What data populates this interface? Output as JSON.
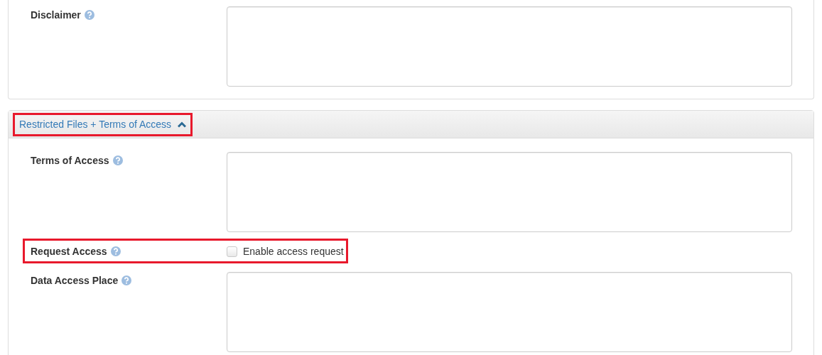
{
  "panels": [
    {
      "fields": [
        {
          "kind": "textarea",
          "label": "Disclaimer",
          "help": true,
          "highlighted": false
        }
      ]
    },
    {
      "header": {
        "title": "Restricted Files + Terms of Access",
        "expanded": true,
        "highlighted": true
      },
      "fields": [
        {
          "kind": "textarea",
          "label": "Terms of Access",
          "help": true,
          "highlighted": false
        },
        {
          "kind": "checkbox",
          "label": "Request Access",
          "help": true,
          "option": "Enable access request",
          "checked": false,
          "highlighted": true
        },
        {
          "kind": "textarea",
          "label": "Data Access Place",
          "help": true,
          "highlighted": false
        }
      ]
    }
  ]
}
